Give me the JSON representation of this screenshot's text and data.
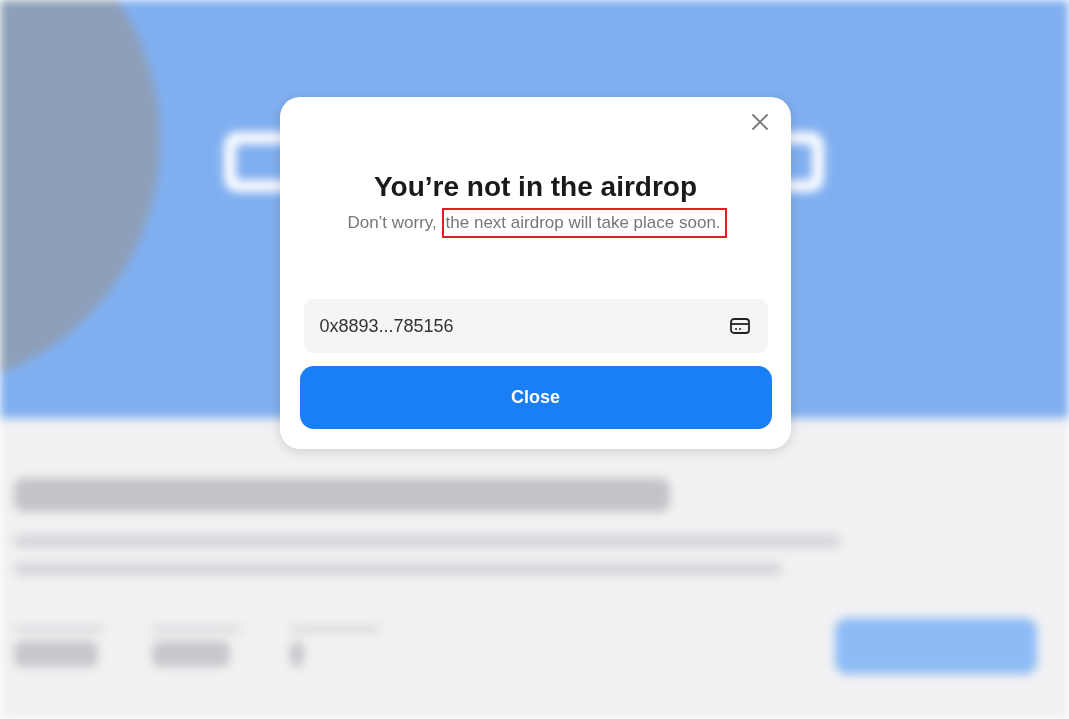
{
  "dialog": {
    "title": "You’re not in the airdrop",
    "message": [
      {
        "text": "Don’t worry,",
        "highlighted": false
      },
      {
        "text": "the next airdrop will take place soon.",
        "highlighted": true
      }
    ],
    "address": {
      "value": "0x8893...785156"
    },
    "button": "Close"
  }
}
